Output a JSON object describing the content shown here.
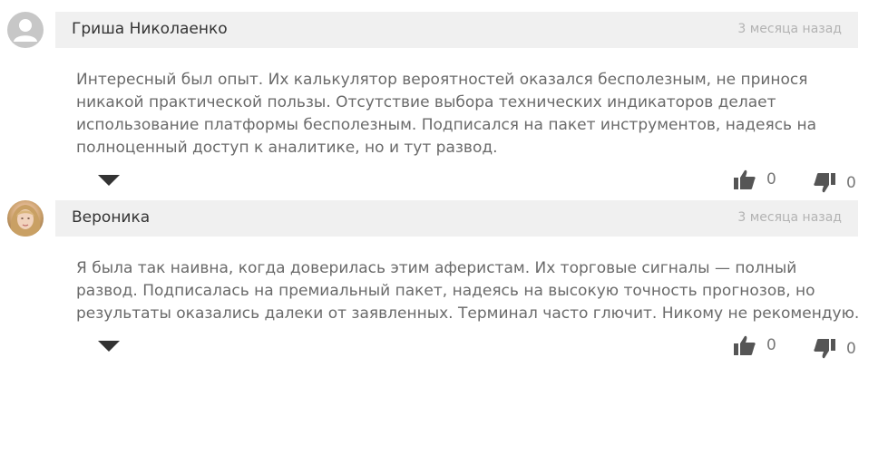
{
  "comments": [
    {
      "author": "Гриша Николаенко",
      "date": "3 месяца назад",
      "lines": [
        "Интересный был опыт. Их калькулятор вероятностей оказался бесполезным, не принося",
        "никакой практической пользы. Отсутствие выбора технических индикаторов делает",
        "использование платформы бесполезным. Подписался на пакет инструментов, надеясь на",
        "полноценный доступ к аналитике, но и тут развод."
      ],
      "likes": "0",
      "dislikes": "0",
      "avatar_icon": "default-user-icon"
    },
    {
      "author": "Вероника",
      "date": "3 месяца назад",
      "lines": [
        "Я была так наивна, когда доверилась этим аферистам. Их торговые сигналы — полный",
        "развод. Подписалась на премиальный пакет, надеясь на высокую точность прогнозов, но",
        "результаты оказались далеки от заявленных. Терминал часто глючит. Никому не рекомендую."
      ],
      "likes": "0",
      "dislikes": "0",
      "avatar_icon": "user-photo"
    }
  ],
  "icons": {
    "like": "thumbs-up-icon",
    "dislike": "thumbs-down-icon",
    "toggle": "caret-down-icon"
  },
  "colors": {
    "header_bg": "#f0f0f0",
    "text": "#6a6a6a",
    "author": "#333333",
    "date": "#b3b3b3",
    "icon": "#555555"
  }
}
